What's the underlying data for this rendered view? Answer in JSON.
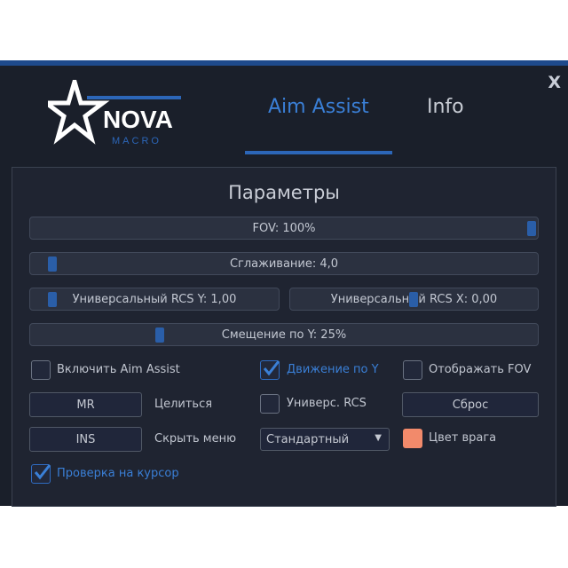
{
  "window": {
    "close_label": "X"
  },
  "logo": {
    "main": "NOVA",
    "sub": "MACRO"
  },
  "tabs": [
    {
      "label": "Aim Assist",
      "active": true
    },
    {
      "label": "Info",
      "active": false
    }
  ],
  "panel": {
    "title": "Параметры",
    "sliders": {
      "fov": {
        "label": "FOV: 100%",
        "value_percent": 100
      },
      "smoothing": {
        "label": "Сглаживание: 4,0",
        "value": 4.0
      },
      "rcs_y": {
        "label": "Универсальный RCS Y: 1,00",
        "value": 1.0
      },
      "rcs_x": {
        "label": "Универсальный RCS X: 0,00",
        "value": 0.0
      },
      "offset_y": {
        "label": "Смещение по Y: 25%",
        "value_percent": 25
      }
    },
    "enable_aim_assist": {
      "label": "Включить Aim Assist",
      "checked": false
    },
    "move_y": {
      "label": "Движение по Y",
      "checked": true
    },
    "show_fov": {
      "label": "Отображать FOV",
      "checked": false
    },
    "aim_key": {
      "key": "MR",
      "label": "Целиться"
    },
    "universal_rcs": {
      "label": "Универс. RCS",
      "checked": false
    },
    "reset_label": "Сброс",
    "hide_menu_key": {
      "key": "INS",
      "label": "Скрыть меню"
    },
    "mode_select": {
      "value": "Стандартный"
    },
    "enemy_color": {
      "label": "Цвет врага",
      "color": "#f28a6b"
    },
    "cursor_check": {
      "label": "Проверка на курсор",
      "checked": true
    }
  },
  "colors": {
    "accent": "#3a7fd6",
    "background": "#1a1f2a",
    "panel": "#1f2431"
  }
}
